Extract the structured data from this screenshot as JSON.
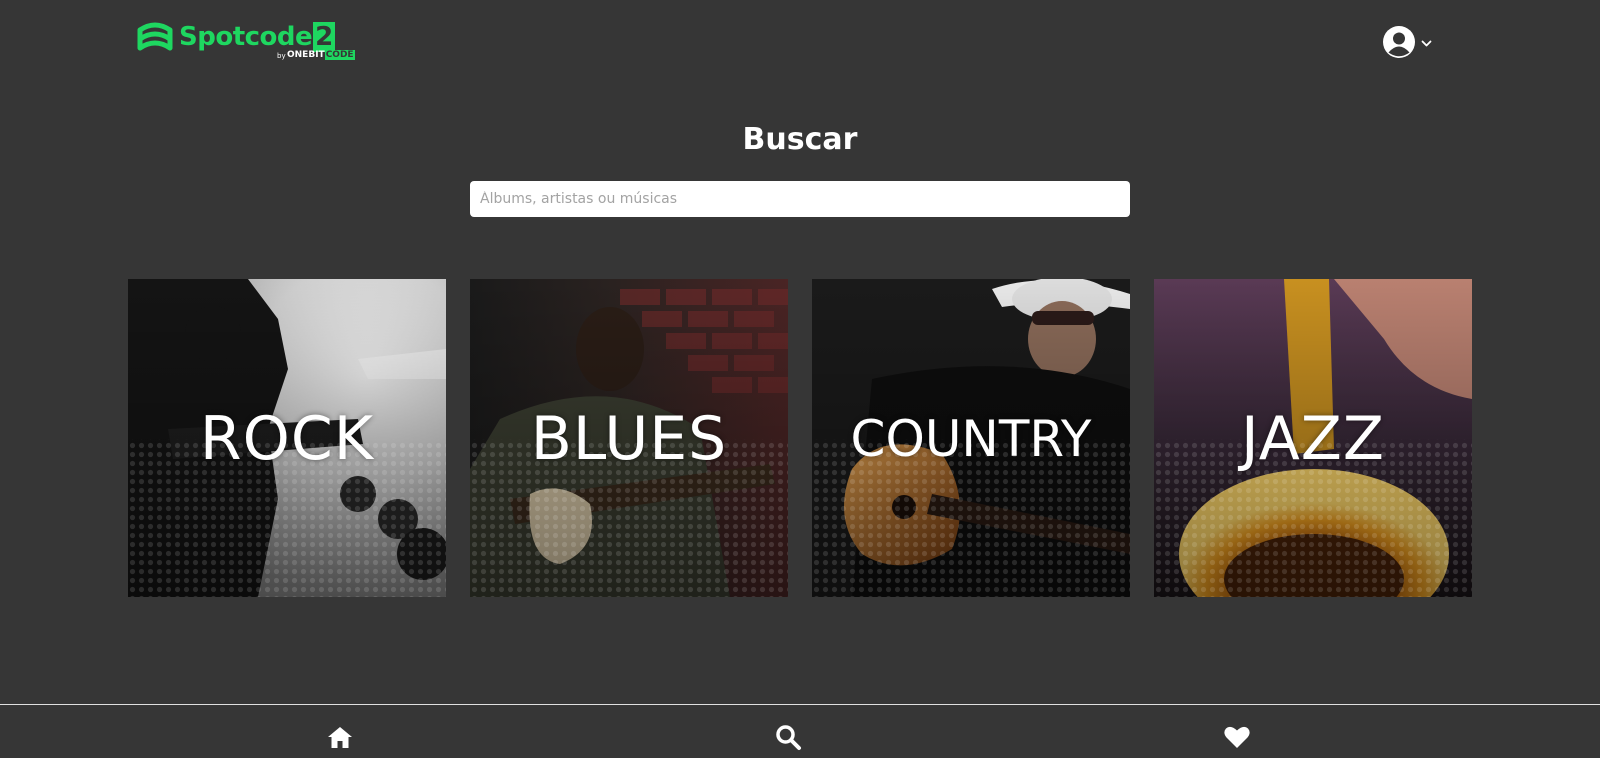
{
  "header": {
    "logo": {
      "name": "Spotcode",
      "number": "2",
      "by": "by",
      "brand": "ONEBIT",
      "brand_code": "CODE"
    },
    "user_menu": {
      "avatar_icon": "user-circle-icon",
      "chevron_icon": "chevron-down-icon"
    }
  },
  "main": {
    "title": "Buscar",
    "search": {
      "value": "",
      "placeholder": "Álbums, artistas ou músicas"
    },
    "genres": [
      {
        "label": "ROCK"
      },
      {
        "label": "BLUES"
      },
      {
        "label": "COUNTRY"
      },
      {
        "label": "JAZZ"
      }
    ]
  },
  "bottom_nav": {
    "items": [
      {
        "icon": "home-icon"
      },
      {
        "icon": "search-icon"
      },
      {
        "icon": "heart-icon"
      }
    ]
  },
  "colors": {
    "background": "#363636",
    "accent": "#1ed760",
    "text": "#ffffff"
  }
}
